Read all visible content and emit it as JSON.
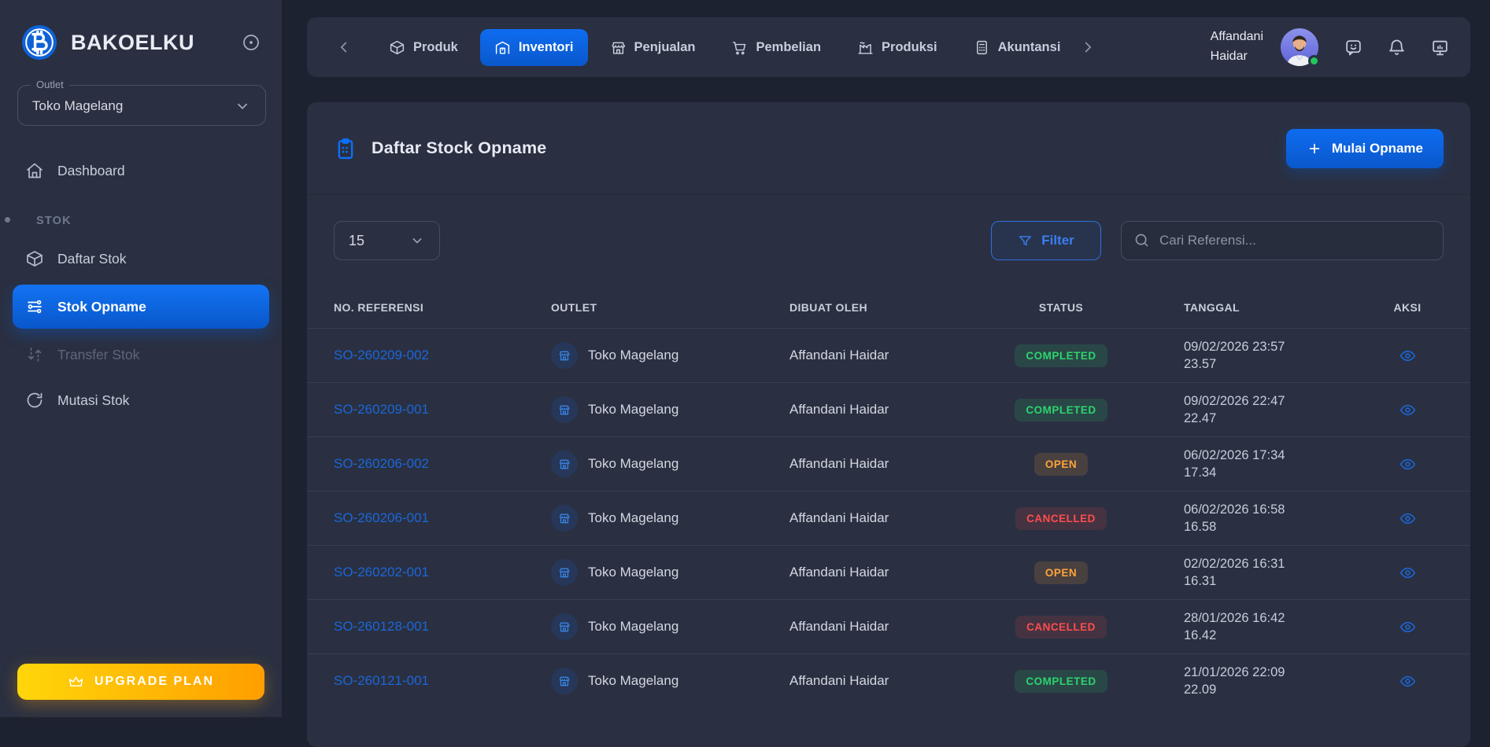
{
  "brand": {
    "name": "BAKOELKU",
    "logo_icon": "bitcoin-icon",
    "collapse_icon": "circle-dot-icon"
  },
  "sidebar": {
    "outlet": {
      "label": "Outlet",
      "value": "Toko Magelang",
      "icon": "chevron-down-icon"
    },
    "items": [
      {
        "label": "Dashboard",
        "icon": "home-icon",
        "active": false
      }
    ],
    "section_label": "STOK",
    "stok_items": [
      {
        "label": "Daftar Stok",
        "icon": "cube-icon",
        "active": false,
        "disabled": false
      },
      {
        "label": "Stok Opname",
        "icon": "sliders-icon",
        "active": true,
        "disabled": false
      },
      {
        "label": "Transfer Stok",
        "icon": "transfer-icon",
        "active": false,
        "disabled": true
      },
      {
        "label": "Mutasi Stok",
        "icon": "rotate-icon",
        "active": false,
        "disabled": false
      }
    ],
    "upgrade": {
      "label": "UPGRADE PLAN",
      "icon": "crown-icon"
    }
  },
  "topnav": {
    "tabs": [
      {
        "label": "Produk",
        "icon": "package-icon",
        "active": false
      },
      {
        "label": "Inventori",
        "icon": "warehouse-icon",
        "active": true
      },
      {
        "label": "Penjualan",
        "icon": "store-icon",
        "active": false
      },
      {
        "label": "Pembelian",
        "icon": "cart-icon",
        "active": false
      },
      {
        "label": "Produksi",
        "icon": "factory-icon",
        "active": false
      },
      {
        "label": "Akuntansi",
        "icon": "calculator-icon",
        "active": false
      }
    ],
    "user": {
      "full": "Affandani Haidar",
      "line1": "Affandani",
      "line2": "Haidar",
      "online": true
    },
    "action_icons": [
      "message-smile-icon",
      "bell-icon",
      "monitor-chart-icon"
    ]
  },
  "page": {
    "title": "Daftar Stock Opname",
    "title_icon": "clipboard-icon",
    "primary_action": "Mulai Opname",
    "page_size": "15",
    "filter_label": "Filter",
    "search_placeholder": "Cari Referensi...",
    "search_value": ""
  },
  "table": {
    "columns": [
      "NO. REFERENSI",
      "OUTLET",
      "DIBUAT OLEH",
      "STATUS",
      "TANGGAL",
      "AKSI"
    ],
    "rows": [
      {
        "ref": "SO-260209-002",
        "outlet": "Toko Magelang",
        "created_by": "Affandani Haidar",
        "status": "COMPLETED",
        "date": "09/02/2026 23:57",
        "time": "23.57"
      },
      {
        "ref": "SO-260209-001",
        "outlet": "Toko Magelang",
        "created_by": "Affandani Haidar",
        "status": "COMPLETED",
        "date": "09/02/2026 22:47",
        "time": "22.47"
      },
      {
        "ref": "SO-260206-002",
        "outlet": "Toko Magelang",
        "created_by": "Affandani Haidar",
        "status": "OPEN",
        "date": "06/02/2026 17:34",
        "time": "17.34"
      },
      {
        "ref": "SO-260206-001",
        "outlet": "Toko Magelang",
        "created_by": "Affandani Haidar",
        "status": "CANCELLED",
        "date": "06/02/2026 16:58",
        "time": "16.58"
      },
      {
        "ref": "SO-260202-001",
        "outlet": "Toko Magelang",
        "created_by": "Affandani Haidar",
        "status": "OPEN",
        "date": "02/02/2026 16:31",
        "time": "16.31"
      },
      {
        "ref": "SO-260128-001",
        "outlet": "Toko Magelang",
        "created_by": "Affandani Haidar",
        "status": "CANCELLED",
        "date": "28/01/2026 16:42",
        "time": "16.42"
      },
      {
        "ref": "SO-260121-001",
        "outlet": "Toko Magelang",
        "created_by": "Affandani Haidar",
        "status": "COMPLETED",
        "date": "21/01/2026 22:09",
        "time": "22.09"
      }
    ]
  },
  "colors": {
    "page_bg": "#1d2230",
    "panel_bg": "#2a3041",
    "accent_blue": "#0d6efd",
    "link_blue": "#1b66d9",
    "status_completed": "#2dd36f",
    "status_open": "#ffa43b",
    "status_cancelled": "#ff4d4d",
    "upgrade_from": "#ffd60a",
    "upgrade_to": "#ff9e00",
    "online_green": "#22c55e"
  }
}
